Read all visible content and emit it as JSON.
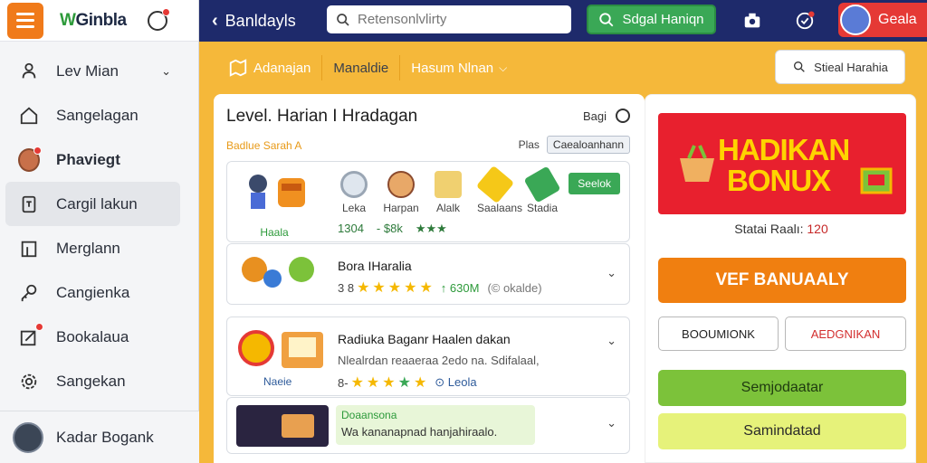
{
  "sidebar": {
    "brand": "Ginbla",
    "brand_prefix": "W",
    "items": [
      {
        "label": "Lev Mian",
        "icon": "user-icon",
        "chevron": true
      },
      {
        "label": "Sangelagan",
        "icon": "home-icon"
      },
      {
        "label": "Phaviegt",
        "icon": "avatar-icon"
      },
      {
        "label": "Cargil lakun",
        "icon": "document-icon"
      },
      {
        "label": "Merglann",
        "icon": "bookmark-icon"
      },
      {
        "label": "Cangienka",
        "icon": "key-icon"
      },
      {
        "label": "Bookalaua",
        "icon": "edit-icon"
      },
      {
        "label": "Sangekan",
        "icon": "gear-icon"
      }
    ],
    "user": "Kadar Bogank"
  },
  "topbar": {
    "back_label": "Banldayls",
    "search_placeholder": "Retensonlvlirty",
    "green_button": "Sdgal Haniqn",
    "user_label": "Geala"
  },
  "subhead": {
    "tabs": [
      "Adanajan",
      "Manaldie",
      "Hasum Nlnan"
    ],
    "filter_button": "Stieal Harahia"
  },
  "card": {
    "title": "Level. Harian I Hradagan",
    "meta": "Bagi",
    "subtitle": "Badlue Sarah A",
    "filter_label": "Plas",
    "filter_value": "Caealoanhann",
    "row1": {
      "main_label": "Haala",
      "items": [
        "Leka",
        "Harpan",
        "Alalk",
        "Saalaans",
        "Stadia"
      ],
      "values": [
        "1304",
        "- $8k",
        "★★★"
      ],
      "button": "Seelok"
    },
    "row2": {
      "title": "Bora IHaralia",
      "meta": "3 8",
      "extra": "↑ 630M",
      "count": "(© okalde)"
    },
    "row3": {
      "title": "Radiuka Baganr Haalen dakan",
      "desc": "Nlealrdan reaaeraa 2edo na. Sdifalaal,",
      "tag": "Naeie",
      "meta": "8-",
      "extra": "⊙ Leola"
    },
    "row4": {
      "tag": "Doaansona",
      "desc": "Wa kananapnad hanjahiraalo."
    }
  },
  "panel": {
    "bonus_line1": "HADIKAN",
    "bonus_line2": "BONUX",
    "status_label": "Statai Raalı:",
    "status_value": "120",
    "primary_button": "VEF BANUAALY",
    "btn_left": "BOOUMIONK",
    "btn_right": "AEDGNIKAN",
    "green_button": "Semjodaatar",
    "yellow_button": "Samindatad"
  }
}
